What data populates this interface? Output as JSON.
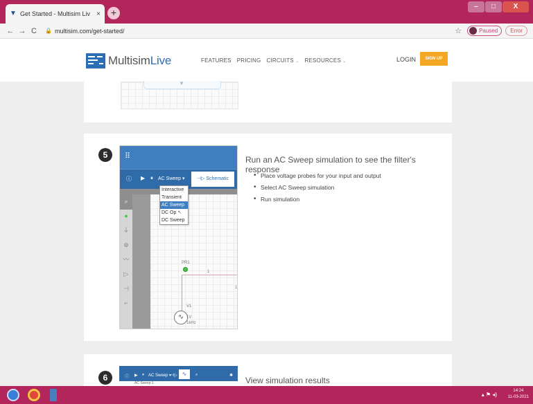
{
  "browser": {
    "tab_title": "Get Started - Multisim Liv",
    "tab_close": "×",
    "new_tab": "+",
    "url": "multisim.com/get-started/",
    "profile_initial": "",
    "profile_status": "Paused",
    "error_label": "Error"
  },
  "site_nav": {
    "logo_prefix": "Multisim",
    "logo_suffix": "Live",
    "menu": [
      "FEATURES",
      "PRICING",
      "CIRCUITS",
      "RESOURCES"
    ],
    "login": "LOGIN",
    "signup": "SIGN UP"
  },
  "step5": {
    "number": "5",
    "heading": "Run an AC Sweep simulation to see the filter's response",
    "bullets": [
      "Place voltage probes for your input and output",
      "Select AC Sweep simulation",
      "Run simulation"
    ],
    "sim": {
      "selected_analysis": "AC Sweep",
      "schematic_button": "Schematic",
      "dropdown_options": [
        "Interactive",
        "Transient",
        "AC Sweep",
        "DC Op",
        "DC Sweep"
      ],
      "active_option": "AC Sweep",
      "probe_label": "PR1",
      "wire_label_1": "1",
      "wire_label_2": "1",
      "source_name": "V1",
      "source_voltage": "1V",
      "source_freq": "1kHz"
    }
  },
  "step6": {
    "number": "6",
    "heading": "View simulation results",
    "sim": {
      "selected_analysis": "AC Sweep",
      "sweep_tab": "AC Sweep 1"
    }
  },
  "taskbar": {
    "time": "14:24",
    "date": "11-03-2021"
  }
}
